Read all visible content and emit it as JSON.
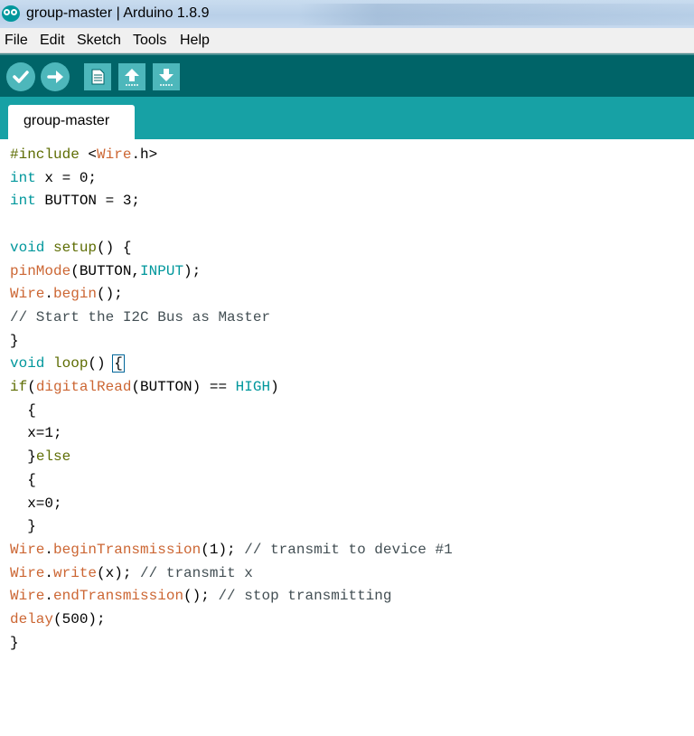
{
  "window": {
    "title": "group-master | Arduino 1.8.9"
  },
  "menu": [
    "File",
    "Edit",
    "Sketch",
    "Tools",
    "Help"
  ],
  "toolbar": {
    "buttons": [
      {
        "name": "verify",
        "icon": "check-icon"
      },
      {
        "name": "upload",
        "icon": "arrow-right-icon"
      },
      {
        "name": "new",
        "icon": "new-file-icon"
      },
      {
        "name": "open",
        "icon": "arrow-up-icon"
      },
      {
        "name": "save",
        "icon": "arrow-down-icon"
      }
    ]
  },
  "tabs": [
    {
      "label": "group-master",
      "active": true
    }
  ],
  "code": [
    [
      [
        "pp",
        "#include "
      ],
      [
        "",
        "<"
      ],
      [
        "kw",
        "Wire"
      ],
      [
        "",
        ".h>"
      ]
    ],
    [
      [
        "ty",
        "int"
      ],
      [
        "",
        " x = 0;"
      ]
    ],
    [
      [
        "ty",
        "int"
      ],
      [
        "",
        " BUTTON = 3;"
      ]
    ],
    [],
    [
      [
        "ty",
        "void"
      ],
      [
        "",
        " "
      ],
      [
        "fn",
        "setup"
      ],
      [
        "",
        "() {"
      ]
    ],
    [
      [
        "kw",
        "pinMode"
      ],
      [
        "",
        "(BUTTON,"
      ],
      [
        "ty",
        "INPUT"
      ],
      [
        "",
        ");"
      ]
    ],
    [
      [
        "kw",
        "Wire"
      ],
      [
        "",
        "."
      ],
      [
        "kw",
        "begin"
      ],
      [
        "",
        "();"
      ]
    ],
    [
      [
        "cm",
        "// Start the I2C Bus as Master"
      ]
    ],
    [
      [
        "",
        "}"
      ]
    ],
    [
      [
        "ty",
        "void"
      ],
      [
        "",
        " "
      ],
      [
        "fn",
        "loop"
      ],
      [
        "",
        "() "
      ],
      [
        "brace",
        "{"
      ]
    ],
    [
      [
        "fn",
        "if"
      ],
      [
        "",
        "("
      ],
      [
        "kw",
        "digitalRead"
      ],
      [
        "",
        "(BUTTON) == "
      ],
      [
        "ty",
        "HIGH"
      ],
      [
        "",
        ")"
      ]
    ],
    [
      [
        "",
        "  {"
      ]
    ],
    [
      [
        "",
        "  x=1;"
      ]
    ],
    [
      [
        "",
        "  }"
      ],
      [
        "fn",
        "else"
      ]
    ],
    [
      [
        "",
        "  {"
      ]
    ],
    [
      [
        "",
        "  x=0;"
      ]
    ],
    [
      [
        "",
        "  }"
      ]
    ],
    [
      [
        "kw",
        "Wire"
      ],
      [
        "",
        "."
      ],
      [
        "kw",
        "beginTransmission"
      ],
      [
        "",
        "(1); "
      ],
      [
        "cm",
        "// transmit to device #1"
      ]
    ],
    [
      [
        "kw",
        "Wire"
      ],
      [
        "",
        "."
      ],
      [
        "kw",
        "write"
      ],
      [
        "",
        "(x); "
      ],
      [
        "cm",
        "// transmit x"
      ]
    ],
    [
      [
        "kw",
        "Wire"
      ],
      [
        "",
        "."
      ],
      [
        "kw",
        "endTransmission"
      ],
      [
        "",
        "(); "
      ],
      [
        "cm",
        "// stop transmitting"
      ]
    ],
    [
      [
        "kw",
        "delay"
      ],
      [
        "",
        "(500);"
      ]
    ],
    [
      [
        "",
        "}"
      ]
    ]
  ],
  "colors": {
    "toolbar_bg": "#006468",
    "tab_strip_bg": "#17a1a5",
    "keyword_orange": "#cc6633",
    "type_teal": "#00979c",
    "function_olive": "#5e6d03"
  }
}
